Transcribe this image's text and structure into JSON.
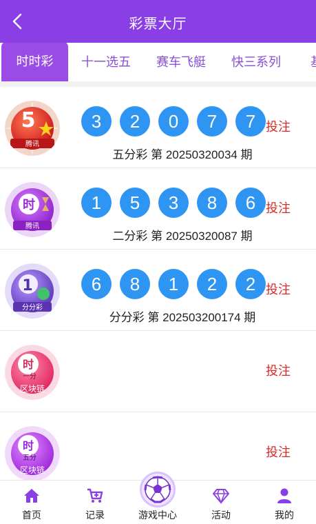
{
  "header": {
    "title": "彩票大厅",
    "back_icon": "chevron-left-icon"
  },
  "tabs": [
    {
      "label": "时时彩",
      "active": true
    },
    {
      "label": "十一选五",
      "active": false
    },
    {
      "label": "赛车飞艇",
      "active": false
    },
    {
      "label": "快三系列",
      "active": false
    },
    {
      "label": "基",
      "active": false
    }
  ],
  "lotteries": [
    {
      "logo_text": "腾讯",
      "logo_glyph": "5",
      "balls": [
        "3",
        "2",
        "0",
        "7",
        "7"
      ],
      "period": "五分彩 第 20250320034 期",
      "bet_label": "投注",
      "color": "#e13b2c"
    },
    {
      "logo_text": "腾讯",
      "logo_glyph": "时",
      "balls": [
        "1",
        "5",
        "3",
        "8",
        "6"
      ],
      "period": "二分彩 第 20250320087 期",
      "bet_label": "投注",
      "color": "#a82fe0"
    },
    {
      "logo_text": "分分彩",
      "logo_glyph": "1",
      "balls": [
        "6",
        "8",
        "1",
        "2",
        "2"
      ],
      "period": "分分彩 第 202503200174 期",
      "bet_label": "投注",
      "color": "#7c52d6"
    },
    {
      "logo_text": "区块链",
      "logo_glyph": "时",
      "logo_sub": "一分",
      "balls": [],
      "period": "",
      "bet_label": "投注",
      "color": "#f0507a"
    },
    {
      "logo_text": "区块链",
      "logo_glyph": "时",
      "logo_sub": "五分",
      "balls": [],
      "period": "",
      "bet_label": "投注",
      "color": "#b83ee8"
    }
  ],
  "tabbar": [
    {
      "label": "首页",
      "icon": "home-icon"
    },
    {
      "label": "记录",
      "icon": "cart-icon"
    },
    {
      "label": "游戏中心",
      "icon": "soccer-ball-icon"
    },
    {
      "label": "活动",
      "icon": "diamond-icon"
    },
    {
      "label": "我的",
      "icon": "user-icon"
    }
  ],
  "colors": {
    "brand": "#8a3fe6",
    "ball": "#2f95f2",
    "bet": "#d82929",
    "tab_icon": "#8a3fe6"
  }
}
